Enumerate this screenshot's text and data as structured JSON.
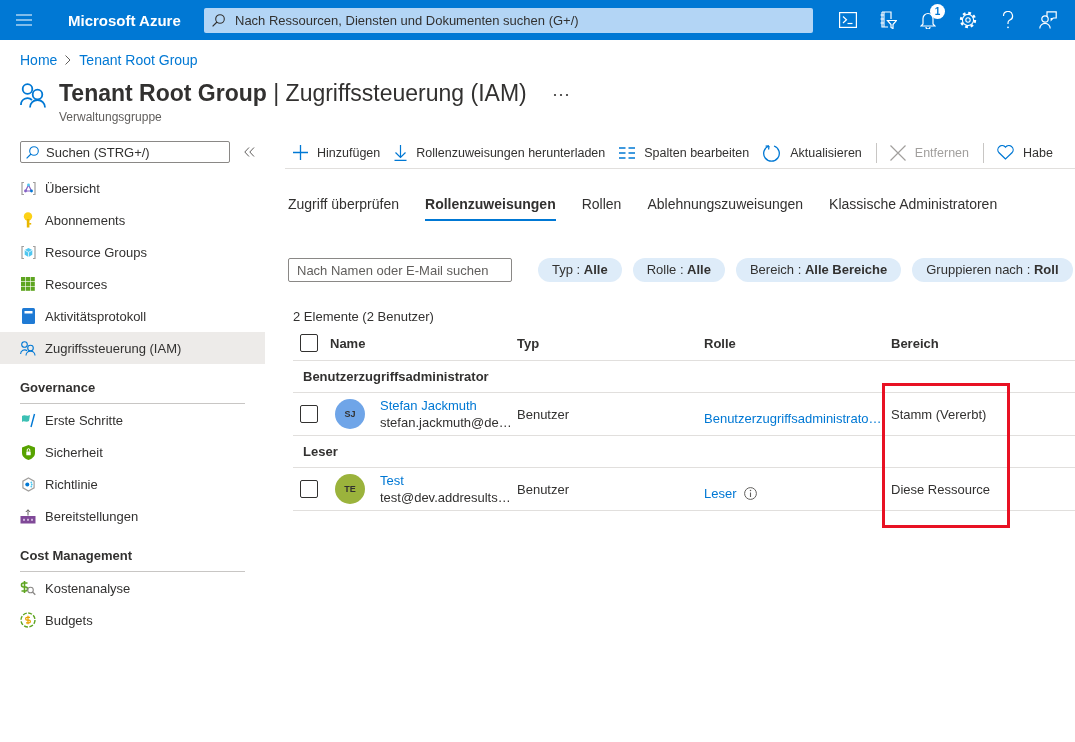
{
  "top_bar": {
    "brand": "Microsoft Azure",
    "search": {
      "placeholder": "Nach Ressourcen, Diensten und Dokumenten suchen (G+/)"
    },
    "notification_count": "1"
  },
  "breadcrumb": [
    "Home",
    "Tenant Root Group"
  ],
  "header": {
    "title": "**Tenant Root Group** | Zugriffssteuerung (IAM)",
    "subtitle": "Verwaltungsgruppe"
  },
  "sidebar": {
    "search": {
      "placeholder": "Suchen (STRG+/)"
    },
    "items": [
      {
        "label": "Übersicht",
        "selected": false
      },
      {
        "label": "Abonnements",
        "selected": false
      },
      {
        "label": "Resource Groups",
        "selected": false
      },
      {
        "label": "Resources",
        "selected": false
      },
      {
        "label": "Aktivitätsprotokoll",
        "selected": false
      },
      {
        "label": "Zugriffssteuerung (IAM)",
        "selected": true
      }
    ],
    "sections": [
      {
        "title": "Governance",
        "items": [
          {
            "label": "Erste Schritte",
            "selected": false
          },
          {
            "label": "Sicherheit",
            "selected": false
          },
          {
            "label": "Richtlinie",
            "selected": false
          },
          {
            "label": "Bereitstellungen",
            "selected": false
          }
        ]
      },
      {
        "title": "Cost Management",
        "items": [
          {
            "label": "Kostenanalyse",
            "selected": false
          },
          {
            "label": "Budgets",
            "selected": false
          }
        ]
      }
    ]
  },
  "toolbar": [
    {
      "label": "Hinzufügen",
      "disabled": false,
      "separator_before": false
    },
    {
      "label": "Rollenzuweisungen herunterladen",
      "disabled": false,
      "separator_before": false
    },
    {
      "label": "Spalten bearbeiten",
      "disabled": false,
      "separator_before": false
    },
    {
      "label": "Aktualisieren",
      "disabled": false,
      "separator_before": false
    },
    {
      "label": "Entfernen",
      "disabled": true,
      "separator_before": true
    },
    {
      "label": "Habe",
      "disabled": false,
      "separator_before": true
    }
  ],
  "tabs": [
    {
      "label": "Zugriff überprüfen",
      "selected": false
    },
    {
      "label": "Rollenzuweisungen",
      "selected": true
    },
    {
      "label": "Rollen",
      "selected": false
    },
    {
      "label": "Ablehnungszuweisungen",
      "selected": false
    },
    {
      "label": "Klassische Administratoren",
      "selected": false
    }
  ],
  "filter": {
    "search": {
      "placeholder": "Nach Namen oder E-Mail suchen"
    },
    "chips": [
      "Typ : **Alle**",
      "Rolle : **Alle**",
      "Bereich : **Alle Bereiche**",
      "Gruppieren nach : **Roll**"
    ]
  },
  "table": {
    "count": "2 Elemente (2 Benutzer)",
    "select_all": {
      "checked": false
    },
    "columns": [
      "Name",
      "Typ",
      "Rolle",
      "Bereich"
    ],
    "groups": [
      {
        "title": "Benutzerzugriffsadministrator",
        "rows": [
          {
            "checked": false,
            "initials": "SJ",
            "color": "#6fa5e8",
            "name": "Stefan Jackmuth",
            "email": "stefan.jackmuth@de…",
            "type": "Benutzer",
            "role": "Benutzerzugriffsadministrato…",
            "role_info": false,
            "scope": "Stamm (Vererbt)"
          }
        ]
      },
      {
        "title": "Leser",
        "rows": [
          {
            "checked": false,
            "initials": "TE",
            "color": "#9bb33c",
            "name": "Test",
            "email": "test@dev.addresults…",
            "type": "Benutzer",
            "role": "Leser",
            "role_info": true,
            "scope": "Diese Ressource"
          }
        ]
      }
    ]
  }
}
